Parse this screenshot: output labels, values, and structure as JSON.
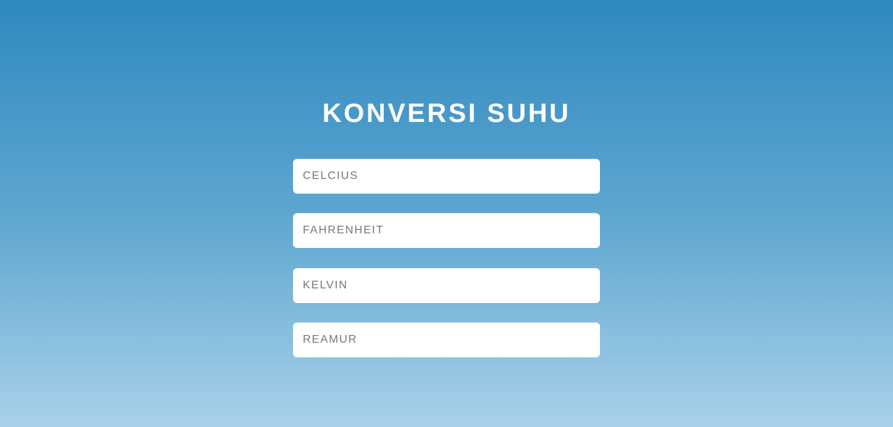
{
  "title": "KONVERSI SUHU",
  "fields": [
    {
      "placeholder": "CELCIUS",
      "value": ""
    },
    {
      "placeholder": "FAHRENHEIT",
      "value": ""
    },
    {
      "placeholder": "KELVIN",
      "value": ""
    },
    {
      "placeholder": "REAMUR",
      "value": ""
    }
  ],
  "colors": {
    "gradient_top": "#2e89bf",
    "gradient_bottom": "#a9d1ea"
  }
}
